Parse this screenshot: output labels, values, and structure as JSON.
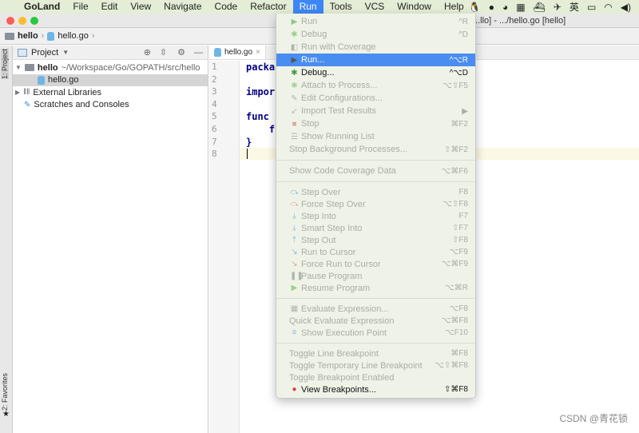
{
  "menubar": {
    "apple": "",
    "app": "GoLand",
    "items": [
      "File",
      "Edit",
      "View",
      "Navigate",
      "Code",
      "Refactor",
      "Run",
      "Tools",
      "VCS",
      "Window",
      "Help"
    ],
    "active": "Run",
    "tray_icons": [
      "qq-icon",
      "browser-icon",
      "wechat-icon",
      "calculator-icon",
      "docker-icon",
      "paper-plane-icon",
      "translate-icon",
      "airplay-icon",
      "wifi-icon",
      "volume-icon"
    ]
  },
  "window": {
    "title": "...llo] - .../hello.go [hello]"
  },
  "breadcrumb": {
    "project": "hello",
    "file": "hello.go"
  },
  "left_strip": {
    "project": "1: Project",
    "favorites": "2: Favorites"
  },
  "project_panel": {
    "title": "Project",
    "tree": [
      {
        "label": "hello",
        "path": "~/Workspace/Go/GOPATH/src/hello",
        "type": "folder"
      },
      {
        "label": "hello.go",
        "type": "file",
        "selected": true
      },
      {
        "label": "External Libraries",
        "type": "libs"
      },
      {
        "label": "Scratches and Consoles",
        "type": "scratches"
      }
    ]
  },
  "editor": {
    "tab": "hello.go",
    "line_numbers": [
      "1",
      "2",
      "3",
      "4",
      "5",
      "6",
      "7",
      "8"
    ],
    "lines": [
      "packa",
      "",
      "impor",
      "",
      "func",
      "    f",
      "}",
      ""
    ]
  },
  "run_menu": [
    {
      "label": "Run",
      "shortcut": "^R",
      "icon": "run-icon",
      "glyph": "▶",
      "color": "#8cc98c"
    },
    {
      "label": "Debug",
      "shortcut": "^D",
      "icon": "debug-icon",
      "glyph": "✱",
      "color": "#9ccf8c"
    },
    {
      "label": "Run with Coverage",
      "shortcut": "",
      "icon": "coverage-icon",
      "glyph": "◧",
      "color": "#b0b4ac"
    },
    {
      "label": "Run...",
      "shortcut": "^⌥R",
      "icon": "run-icon",
      "glyph": "▶",
      "color": "#555",
      "highlighted": true,
      "enabled": true
    },
    {
      "label": "Debug...",
      "shortcut": "^⌥D",
      "icon": "debug-icon",
      "glyph": "✱",
      "color": "#3c9a3c",
      "enabled": true
    },
    {
      "label": "Attach to Process...",
      "shortcut": "⌥⇧F5",
      "icon": "attach-icon",
      "glyph": "✱",
      "color": "#a8cfa0"
    },
    {
      "label": "Edit Configurations...",
      "shortcut": "",
      "icon": "edit-icon",
      "glyph": "✎",
      "color": "#b0b4ac"
    },
    {
      "label": "Import Test Results",
      "shortcut": "▶",
      "icon": "import-icon",
      "glyph": "↙",
      "color": "#b0b4ac"
    },
    {
      "label": "Stop",
      "shortcut": "⌘F2",
      "icon": "stop-icon",
      "glyph": "■",
      "color": "#e0a8a0"
    },
    {
      "label": "Show Running List",
      "shortcut": "",
      "icon": "list-icon",
      "glyph": "☰",
      "color": "#b0b4ac"
    },
    {
      "label": "Stop Background Processes...",
      "shortcut": "⇧⌘F2"
    },
    {
      "sep": true
    },
    {
      "label": "Show Code Coverage Data",
      "shortcut": "⌥⌘F6"
    },
    {
      "sep": true
    },
    {
      "label": "Step Over",
      "shortcut": "F8",
      "icon": "step-over-icon",
      "glyph": "⤼",
      "color": "#8cb8e0"
    },
    {
      "label": "Force Step Over",
      "shortcut": "⌥⇧F8",
      "icon": "force-step-over-icon",
      "glyph": "⤼",
      "color": "#e0a0a0"
    },
    {
      "label": "Step Into",
      "shortcut": "F7",
      "icon": "step-into-icon",
      "glyph": "⤓",
      "color": "#8cb8e0"
    },
    {
      "label": "Smart Step Into",
      "shortcut": "⇧F7",
      "icon": "smart-step-into-icon",
      "glyph": "⤓",
      "color": "#8cb8e0"
    },
    {
      "label": "Step Out",
      "shortcut": "⇧F8",
      "icon": "step-out-icon",
      "glyph": "⤒",
      "color": "#8cb8e0"
    },
    {
      "label": "Run to Cursor",
      "shortcut": "⌥F9",
      "icon": "run-to-cursor-icon",
      "glyph": "↘",
      "color": "#8cb8e0"
    },
    {
      "label": "Force Run to Cursor",
      "shortcut": "⌥⌘F9",
      "icon": "force-run-to-cursor-icon",
      "glyph": "↘",
      "color": "#e0a0a0"
    },
    {
      "label": "Pause Program",
      "shortcut": "",
      "icon": "pause-icon",
      "glyph": "❚❚",
      "color": "#b0b4ac"
    },
    {
      "label": "Resume Program",
      "shortcut": "⌥⌘R",
      "icon": "resume-icon",
      "glyph": "▶",
      "color": "#9ccf8c"
    },
    {
      "sep": true
    },
    {
      "label": "Evaluate Expression...",
      "shortcut": "⌥F8",
      "icon": "calculator-icon",
      "glyph": "▦",
      "color": "#b0b4ac"
    },
    {
      "label": "Quick Evaluate Expression",
      "shortcut": "⌥⌘F8"
    },
    {
      "label": "Show Execution Point",
      "shortcut": "⌥F10",
      "icon": "execution-point-icon",
      "glyph": "≡",
      "color": "#8cb8e0"
    },
    {
      "sep": true
    },
    {
      "label": "Toggle Line Breakpoint",
      "shortcut": "⌘F8"
    },
    {
      "label": "Toggle Temporary Line Breakpoint",
      "shortcut": "⌥⇧⌘F8"
    },
    {
      "label": "Toggle Breakpoint Enabled",
      "shortcut": ""
    },
    {
      "label": "View Breakpoints...",
      "shortcut": "⇧⌘F8",
      "icon": "breakpoints-icon",
      "glyph": "●",
      "color": "#d84040",
      "enabled": true
    }
  ],
  "watermark": "CSDN @青花锁",
  "colors": {
    "menubar": "#e4edd6",
    "highlight": "#4a8df0",
    "keyword": "#000080"
  }
}
